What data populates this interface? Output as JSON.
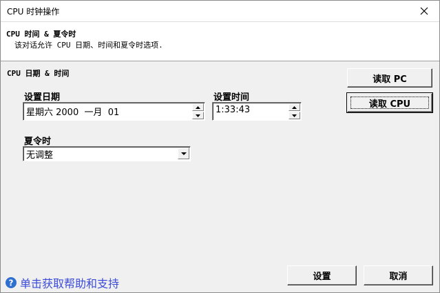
{
  "window": {
    "title": "CPU 时钟操作"
  },
  "header": {
    "title": "CPU 时间 & 夏令时",
    "description": "该对话允许 CPU 日期、时间和夏令时选项."
  },
  "group": {
    "title": "CPU 日期 & 时间"
  },
  "date": {
    "label": "设置日期",
    "value": "星期六 2000  一月  01"
  },
  "time": {
    "label": "设置时间",
    "value": "1:33:43"
  },
  "dst": {
    "label": "夏令时",
    "value": "无调整"
  },
  "buttons": {
    "read_pc": "读取 PC",
    "read_cpu": "读取 CPU",
    "set": "设置",
    "cancel": "取消"
  },
  "help": {
    "label": "单击获取帮助和支持"
  },
  "icons": {
    "close": "close-icon",
    "help": "help-icon",
    "spin_up": "spin-up-icon",
    "spin_down": "spin-down-icon",
    "dropdown": "chevron-down-icon"
  },
  "colors": {
    "help_link": "#3b4bd6",
    "help_icon": "#2f6fd0"
  }
}
